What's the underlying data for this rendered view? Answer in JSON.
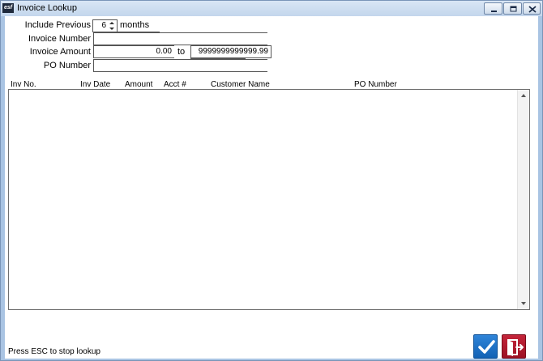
{
  "window": {
    "title": "Invoice Lookup",
    "app_icon_text": "esf"
  },
  "form": {
    "include_previous_label": "Include Previous",
    "include_previous_value": "6",
    "months_label": "months",
    "invoice_number_label": "Invoice Number",
    "invoice_number_value": "",
    "invoice_amount_label": "Invoice Amount",
    "amount_from_value": "0.00",
    "to_label": "to",
    "amount_to_value": "9999999999999.99",
    "po_number_label": "PO Number",
    "po_number_value": ""
  },
  "table": {
    "columns": [
      "Inv No.",
      "Inv Date",
      "Amount",
      "Acct #",
      "Customer Name",
      "PO Number"
    ],
    "rows": []
  },
  "status": {
    "text": "Press ESC to stop lookup"
  },
  "colors": {
    "ok_button": "#1a6fc4",
    "exit_button": "#b01a2e",
    "title_bar": "#c9daee"
  },
  "icons": {
    "ok": "checkmark-icon",
    "exit": "exit-door-icon"
  }
}
